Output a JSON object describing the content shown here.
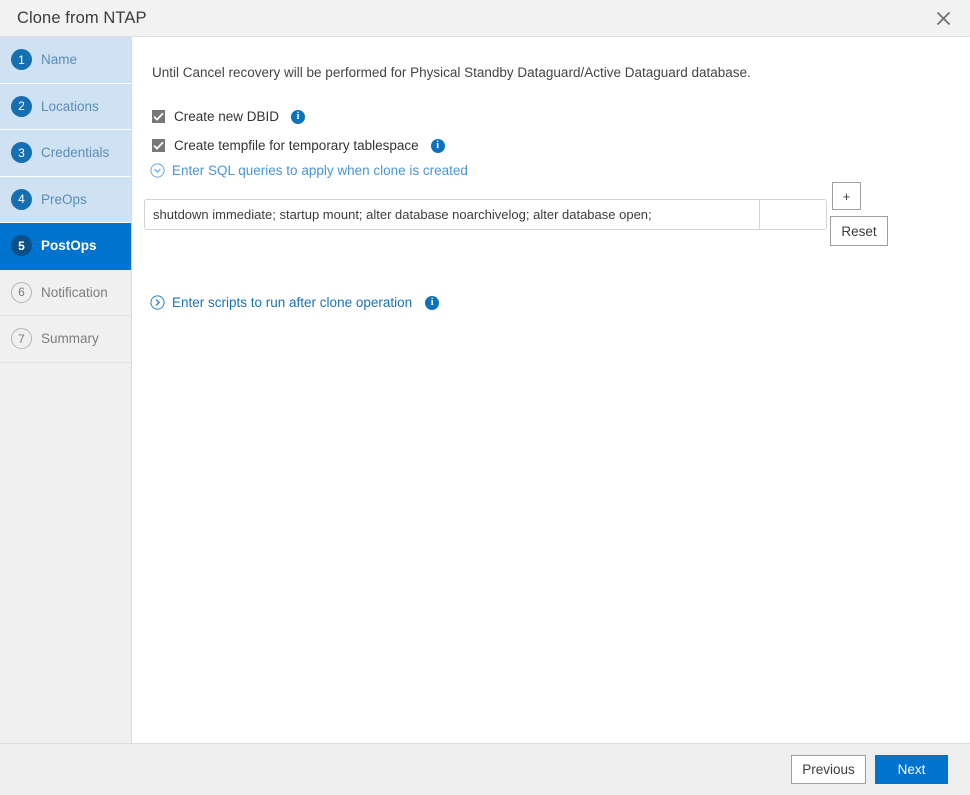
{
  "window": {
    "title": "Clone from NTAP",
    "close_icon": "close-icon"
  },
  "sidebar": {
    "items": [
      {
        "number": "1",
        "label": "Name",
        "state": "done"
      },
      {
        "number": "2",
        "label": "Locations",
        "state": "done"
      },
      {
        "number": "3",
        "label": "Credentials",
        "state": "done"
      },
      {
        "number": "4",
        "label": "PreOps",
        "state": "done"
      },
      {
        "number": "5",
        "label": "PostOps",
        "state": "active"
      },
      {
        "number": "6",
        "label": "Notification",
        "state": "future"
      },
      {
        "number": "7",
        "label": "Summary",
        "state": "future"
      }
    ]
  },
  "main": {
    "intro_text": "Until Cancel recovery will be performed for Physical Standby Dataguard/Active Dataguard database.",
    "checkbox_dbid": {
      "label": "Create new DBID",
      "checked": true,
      "info_icon": "info-icon"
    },
    "checkbox_tempfile": {
      "label": "Create tempfile for temporary tablespace",
      "checked": true,
      "info_icon": "info-icon"
    },
    "sql_section": {
      "expander_label": "Enter SQL queries to apply when clone is created",
      "expander_state": "expanded",
      "expander_icon": "chevron-down-circle-icon",
      "input_value": "shutdown immediate; startup mount; alter database noarchivelog; alter database open;",
      "input_placeholder": "",
      "add_button_label": "+",
      "reset_button_label": "Reset"
    },
    "scripts_section": {
      "expander_label": "Enter scripts to run after clone operation",
      "expander_state": "collapsed",
      "expander_icon": "chevron-right-circle-icon",
      "info_icon": "info-icon"
    }
  },
  "footer": {
    "previous_label": "Previous",
    "next_label": "Next"
  },
  "colors": {
    "accent_blue": "#0073cf",
    "step_done_bg": "#cfe2f3",
    "step_done_text": "#5b8cb8",
    "info_blue": "#0c72ba",
    "titlebar_bg": "#f2f2f2",
    "footer_bg": "#eeeeee"
  }
}
